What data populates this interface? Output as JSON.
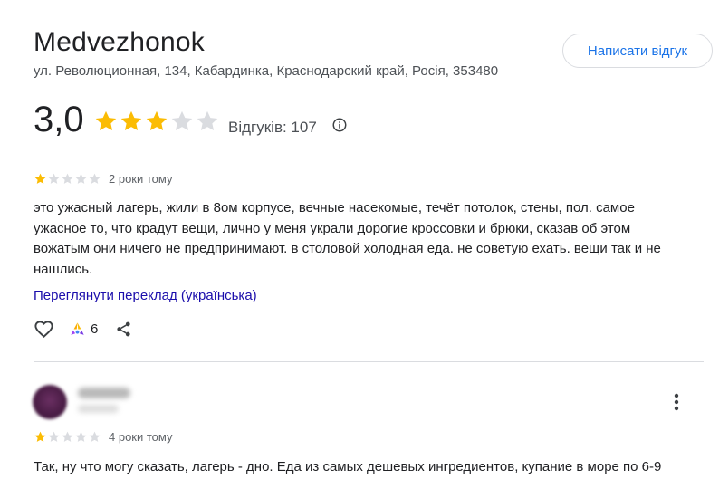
{
  "place": {
    "title": "Medvezhonok",
    "address": "ул. Революционная, 134, Кабардинка, Краснодарский край, Росія, 353480",
    "write_review_label": "Написати відгук",
    "rating": "3,0",
    "rating_value": 3,
    "rating_max": 5,
    "reviews_count": "Відгуків: 107"
  },
  "colors": {
    "star_filled": "#fbbc04",
    "star_empty": "#dadce0",
    "accent_blue": "#1a73e8",
    "link": "#1a0dab"
  },
  "reviews": [
    {
      "rating": 1,
      "time": "2 роки тому",
      "text": "это ужасный лагерь, жили в 8ом корпусе, вечные насекомые, течёт потолок, стены, пол. самое ужасное то, что крадут вещи, лично у меня украли дорогие кроссовки и брюки, сказав об этом вожатым они ничего не предпринимают. в столовой холодная еда. не советую ехать. вещи так и не нашлись.",
      "translate_link": "Переглянути переклад (українська)",
      "likes": "6",
      "icons": [
        "heart-icon",
        "like-hands-icon",
        "share-icon"
      ]
    },
    {
      "author": "████",
      "author_meta": "███",
      "rating": 1,
      "time": "4 роки тому",
      "text": "Так, ну что могу сказать, лагерь - дно. Еда из самых дешевых ингредиентов, купание в море по 6-9"
    }
  ]
}
